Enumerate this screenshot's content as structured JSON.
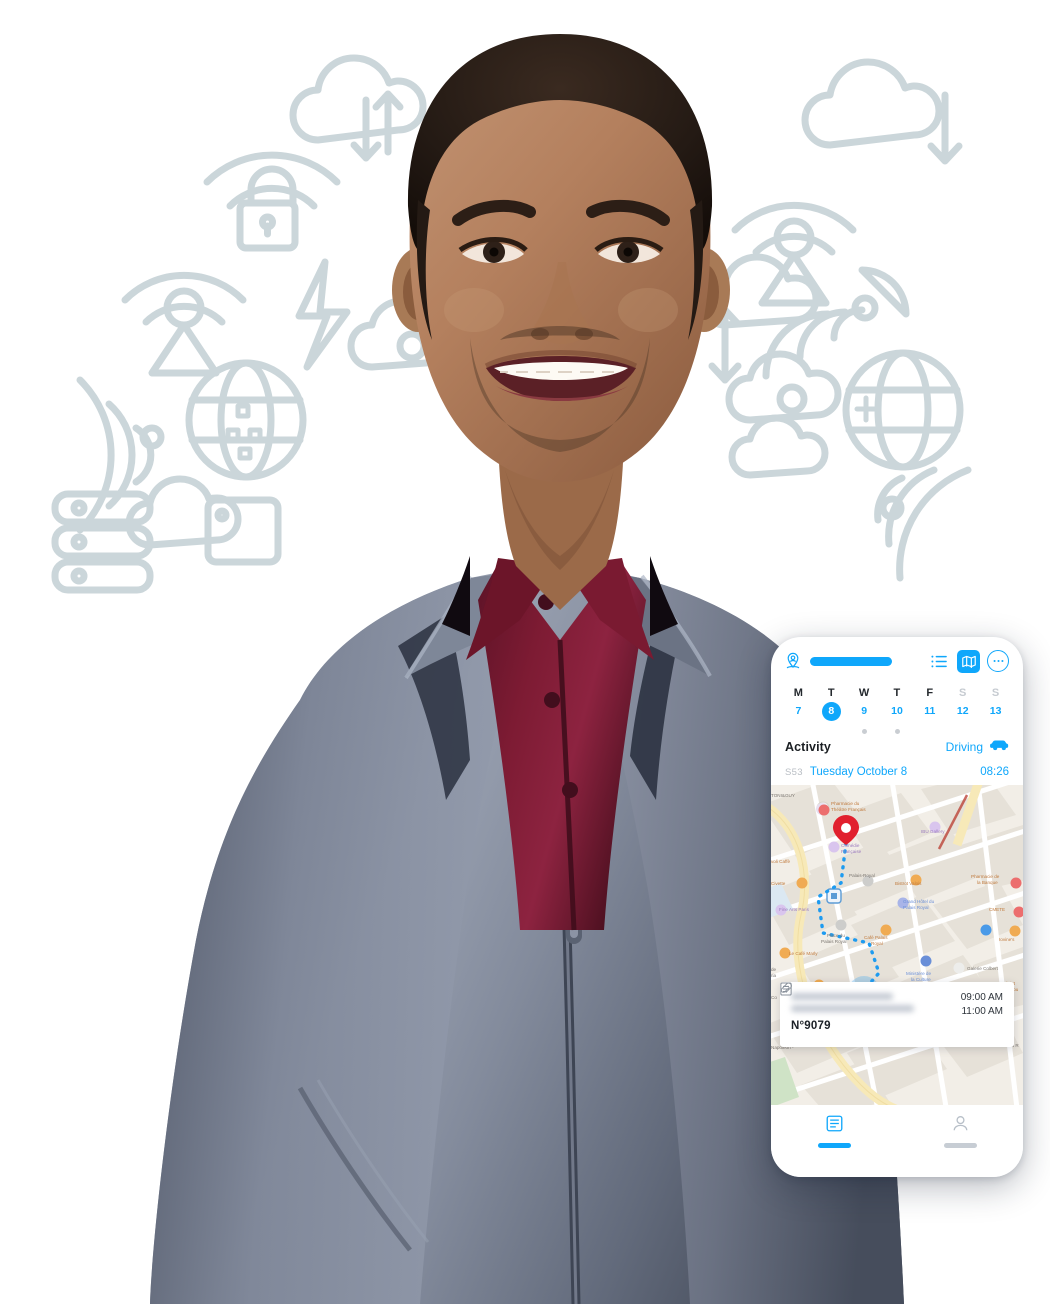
{
  "page": {
    "kind": "marketing-hero",
    "subject": "smiling-man-in-grey-jacket-with-burgundy-shirt",
    "background_icons": [
      "cloud-sync-icon",
      "lock-wifi-icon",
      "broadcast-tower-icon",
      "lightning-bolt-icon",
      "cloud-icon",
      "globe-grid-icon",
      "wifi-signal-icon",
      "server-stack-icon",
      "cloud-upload-icon",
      "satellite-dish-icon",
      "cloud-download-icon",
      "signal-waves-icon",
      "router-icon",
      "globe-plus-icon"
    ],
    "background_icon_color": "#c9d5da",
    "canvas_bg": "#ffffff"
  },
  "phone": {
    "accent": "#0fa7fb",
    "topbar": {
      "location_icon": "map-pin-person-icon",
      "title_redacted": true,
      "list_icon": "list-icon",
      "map_icon": "map-icon",
      "more_icon": "more-horizontal-icon"
    },
    "calendar": {
      "days": [
        {
          "dow": "M",
          "num": "7",
          "selected": false,
          "weekend": false,
          "dot": false
        },
        {
          "dow": "T",
          "num": "8",
          "selected": true,
          "weekend": false,
          "dot": false
        },
        {
          "dow": "W",
          "num": "9",
          "selected": false,
          "weekend": false,
          "dot": true
        },
        {
          "dow": "T",
          "num": "10",
          "selected": false,
          "weekend": false,
          "dot": true
        },
        {
          "dow": "F",
          "num": "11",
          "selected": false,
          "weekend": false,
          "dot": false
        },
        {
          "dow": "S",
          "num": "12",
          "selected": false,
          "weekend": true,
          "dot": false
        },
        {
          "dow": "S",
          "num": "13",
          "selected": false,
          "weekend": true,
          "dot": false
        }
      ]
    },
    "activity": {
      "label": "Activity",
      "mode": "Driving",
      "mode_icon": "car-icon"
    },
    "session": {
      "id": "S53",
      "date": "Tuesday October 8",
      "time": "08:26"
    },
    "map": {
      "provider_style": "street-map-paris",
      "marker_icon": "map-marker-icon",
      "current_location_icon": "current-location-dot",
      "route_style": "dashed-blue",
      "labels": [
        "TONI&GUY",
        "Pharmacie du Théâtre Français",
        "IBU Gallery",
        "Comédie Française",
        "Rivoli Caffè",
        "Palais-Royal",
        "Bistrot Valois",
        "Pharmacie de la Banque",
        "Civette",
        "Grand Hôtel du Palais Royal",
        "CMETE",
        "Fine Arts Paris",
        "Place du Palais Royal",
        "Café Palais Royal",
        "Iovine's",
        "Le Café Marly",
        "Ministère de la Culture",
        "Galerie Colbert",
        "Christ Loubou",
        "Napoléon -",
        "La R"
      ]
    },
    "detail_card": {
      "customer_redacted": true,
      "time_start": "09:00 AM",
      "time_end": "11:00 AM",
      "reference": "N°9079",
      "icons": [
        "document-icon",
        "attachment-icon"
      ]
    },
    "bottom_nav": [
      {
        "icon": "tasks-icon",
        "active": true
      },
      {
        "icon": "profile-icon",
        "active": false
      }
    ]
  }
}
